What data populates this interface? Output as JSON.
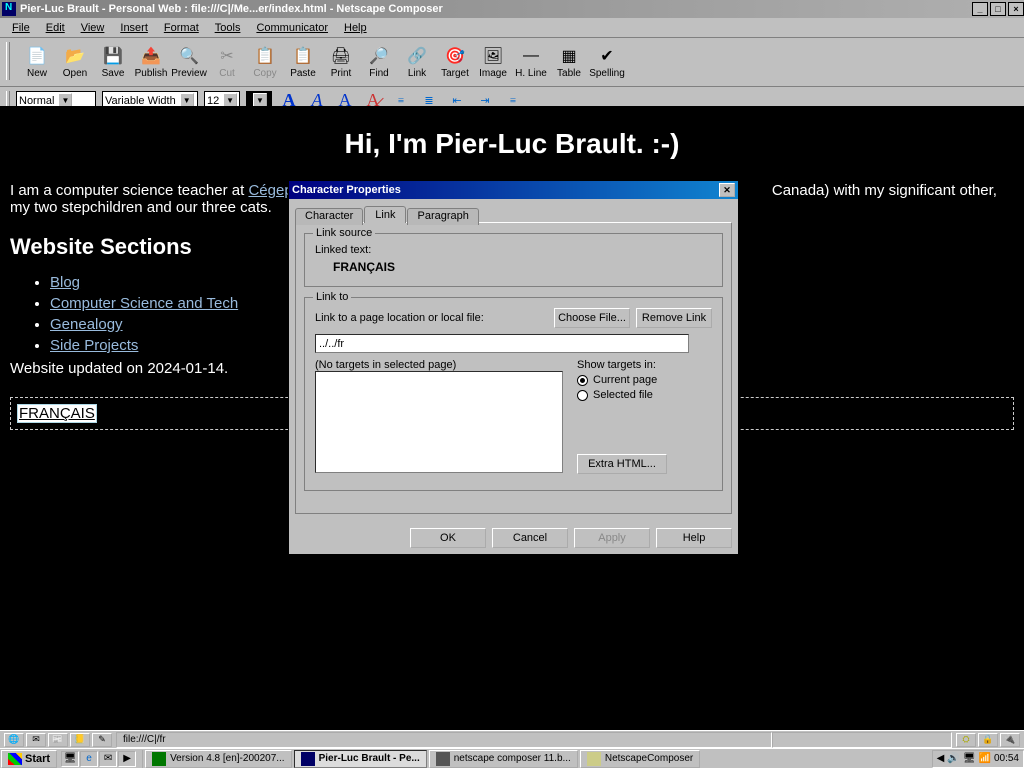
{
  "window": {
    "title": "Pier-Luc Brault - Personal Web : file:///C|/Me...er/index.html - Netscape Composer"
  },
  "menu": [
    "File",
    "Edit",
    "View",
    "Insert",
    "Format",
    "Tools",
    "Communicator",
    "Help"
  ],
  "tools": [
    {
      "label": "New",
      "icon": "📄"
    },
    {
      "label": "Open",
      "icon": "📂"
    },
    {
      "label": "Save",
      "icon": "💾"
    },
    {
      "label": "Publish",
      "icon": "📤"
    },
    {
      "label": "Preview",
      "icon": "🔍"
    },
    {
      "label": "Cut",
      "icon": "✂",
      "disabled": true
    },
    {
      "label": "Copy",
      "icon": "📋",
      "disabled": true
    },
    {
      "label": "Paste",
      "icon": "📋"
    },
    {
      "label": "Print",
      "icon": "🖨"
    },
    {
      "label": "Find",
      "icon": "🔎"
    },
    {
      "label": "Link",
      "icon": "🔗"
    },
    {
      "label": "Target",
      "icon": "🎯"
    },
    {
      "label": "Image",
      "icon": "🖼"
    },
    {
      "label": "H. Line",
      "icon": "—"
    },
    {
      "label": "Table",
      "icon": "▦"
    },
    {
      "label": "Spelling",
      "icon": "✔"
    }
  ],
  "format": {
    "style": "Normal",
    "font": "Variable Width",
    "size": "12"
  },
  "doc": {
    "heading": "Hi, I'm Pier-Luc Brault. :-)",
    "intro_before_link": "I am a computer science teacher at ",
    "intro_link": "Cégep de",
    "intro_after": " Canada) with my significant other, my two stepchildren and our three cats.",
    "sections_title": "Website Sections",
    "links": [
      "Blog",
      "Computer Science and Tech",
      "Genealogy",
      "Side Projects"
    ],
    "updated": "Website updated on 2024-01-14.",
    "selected": "FRANÇAIS"
  },
  "dialog": {
    "title": "Character Properties",
    "tabs": [
      "Character",
      "Link",
      "Paragraph"
    ],
    "active_tab": 1,
    "link_source_label": "Link source",
    "linked_text_label": "Linked text:",
    "linked_text_value": "FRANÇAIS",
    "link_to_label": "Link to",
    "link_desc": "Link to a page location or local file:",
    "choose_file": "Choose File...",
    "remove_link": "Remove Link",
    "url": "../../fr",
    "no_targets": "(No targets in selected page)",
    "show_targets": "Show targets in:",
    "radio_current": "Current page",
    "radio_selected": "Selected file",
    "extra_html": "Extra HTML...",
    "ok": "OK",
    "cancel": "Cancel",
    "apply": "Apply",
    "help": "Help"
  },
  "status": {
    "url": "file:///C|/fr"
  },
  "taskbar": {
    "start": "Start",
    "items": [
      {
        "label": "Version 4.8 [en]-200207...",
        "active": false,
        "color": "#070"
      },
      {
        "label": "Pier-Luc Brault - Pe...",
        "active": true,
        "color": "#006"
      },
      {
        "label": "netscape composer 11.b...",
        "active": false,
        "color": "#555"
      },
      {
        "label": "NetscapeComposer",
        "active": false,
        "color": "#cc8"
      }
    ],
    "clock": "00:54"
  }
}
